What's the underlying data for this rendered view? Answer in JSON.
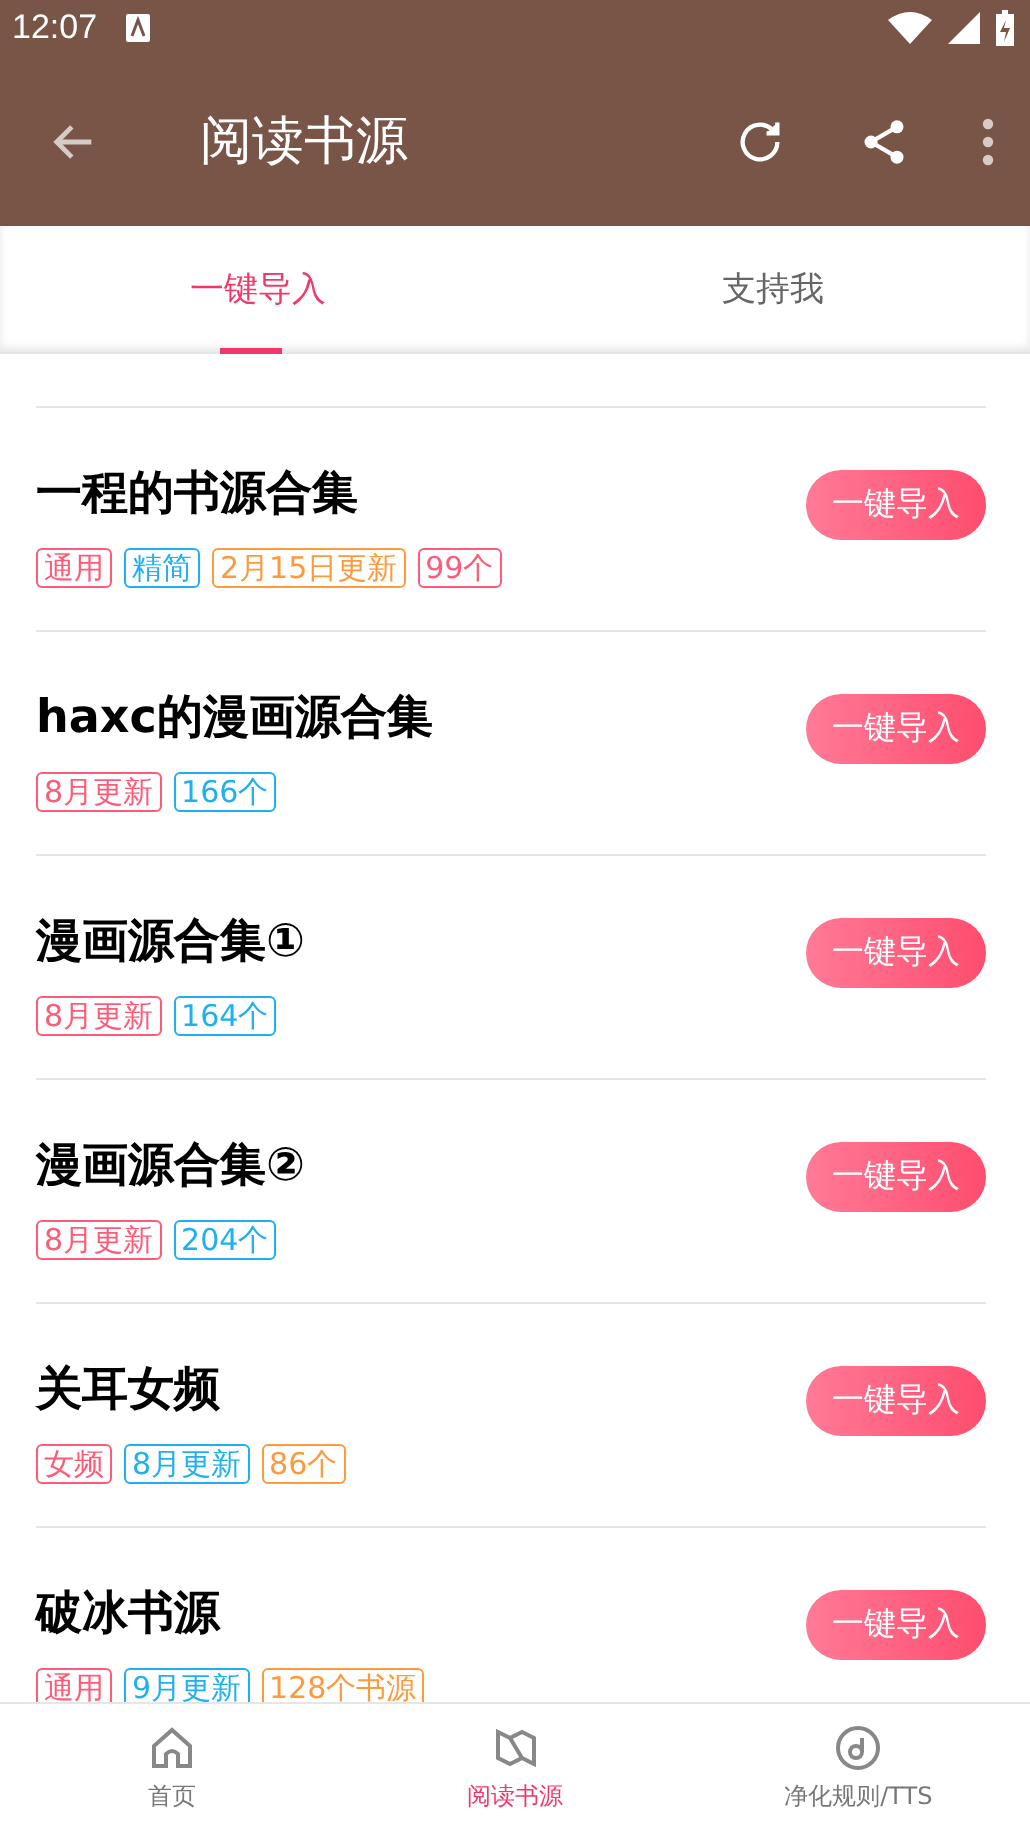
{
  "status_bar": {
    "time": "12:07"
  },
  "toolbar": {
    "title": "阅读书源"
  },
  "tabs": [
    {
      "label": "一键导入",
      "selected": true
    },
    {
      "label": "支持我",
      "selected": false
    }
  ],
  "sources": [
    {
      "title": "一程的书源合集",
      "tags": [
        {
          "text": "通用",
          "color": "#ff5a78"
        },
        {
          "text": "精简",
          "color": "#1fb0f0"
        },
        {
          "text": "2月15日更新",
          "color": "#ff9a3c"
        },
        {
          "text": "99个",
          "color": "#ff5a78"
        }
      ],
      "button": "一键导入"
    },
    {
      "title": "haxc的漫画源合集",
      "tags": [
        {
          "text": "8月更新",
          "color": "#ff5a78"
        },
        {
          "text": "166个",
          "color": "#1fb0f0"
        }
      ],
      "button": "一键导入"
    },
    {
      "title": "漫画源合集①",
      "tags": [
        {
          "text": "8月更新",
          "color": "#ff5a78"
        },
        {
          "text": "164个",
          "color": "#1fb0f0"
        }
      ],
      "button": "一键导入"
    },
    {
      "title": "漫画源合集②",
      "tags": [
        {
          "text": "8月更新",
          "color": "#ff5a78"
        },
        {
          "text": "204个",
          "color": "#1fb0f0"
        }
      ],
      "button": "一键导入"
    },
    {
      "title": "关耳女频",
      "tags": [
        {
          "text": "女频",
          "color": "#ff5a78"
        },
        {
          "text": "8月更新",
          "color": "#1fb0f0"
        },
        {
          "text": "86个",
          "color": "#ff9a3c"
        }
      ],
      "button": "一键导入"
    },
    {
      "title": "破冰书源",
      "tags": [
        {
          "text": "通用",
          "color": "#ff5a78"
        },
        {
          "text": "9月更新",
          "color": "#1fb0f0"
        },
        {
          "text": "128个书源",
          "color": "#ff9a3c"
        }
      ],
      "button": "一键导入"
    }
  ],
  "bottom_nav": [
    {
      "label": "首页",
      "kind": "home",
      "selected": false
    },
    {
      "label": "阅读书源",
      "kind": "source",
      "selected": true
    },
    {
      "label": "净化规则/TTS",
      "kind": "rules",
      "selected": false
    }
  ]
}
